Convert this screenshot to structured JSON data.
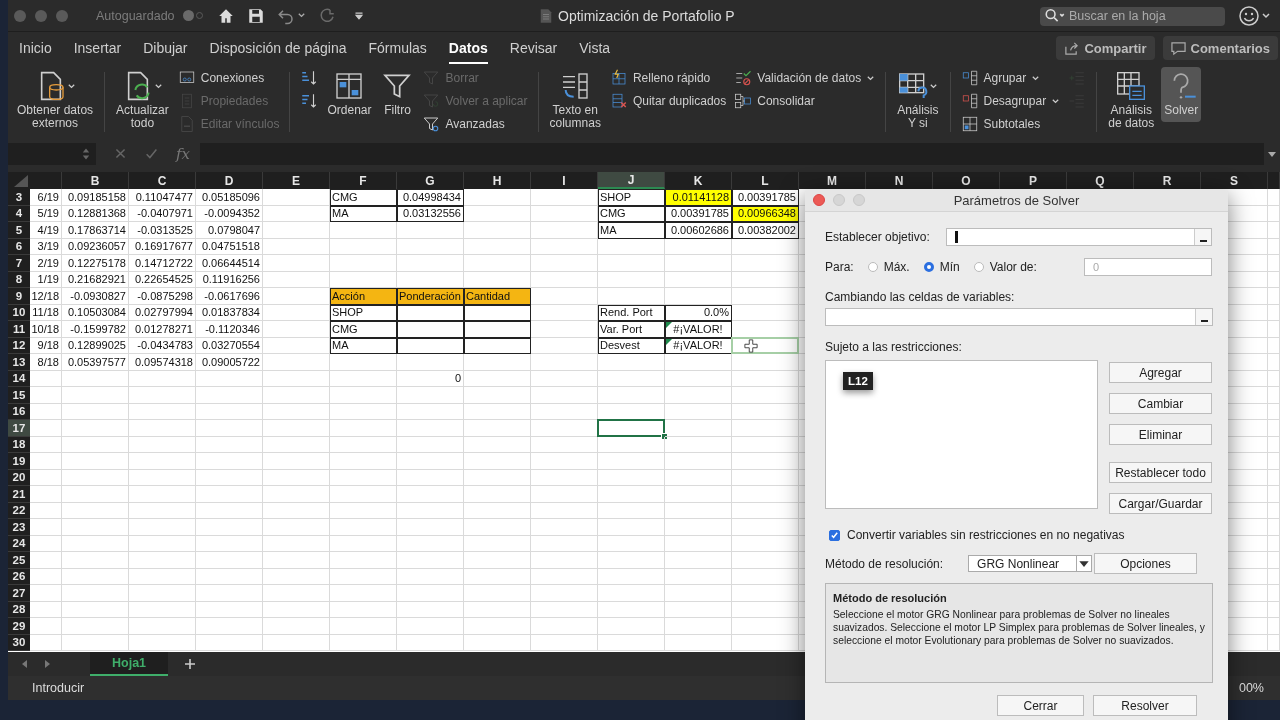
{
  "title_bar": {
    "autosave_label": "Autoguardado",
    "autosave_on": false,
    "title": "Optimización de Portafolio P",
    "search_placeholder": "Buscar en la hoja"
  },
  "tabs": [
    {
      "label": "Inicio",
      "selected": false
    },
    {
      "label": "Insertar",
      "selected": false
    },
    {
      "label": "Dibujar",
      "selected": false
    },
    {
      "label": "Disposición de página",
      "selected": false
    },
    {
      "label": "Fórmulas",
      "selected": false
    },
    {
      "label": "Datos",
      "selected": true
    },
    {
      "label": "Revisar",
      "selected": false
    },
    {
      "label": "Vista",
      "selected": false
    }
  ],
  "actions": [
    "Compartir",
    "Comentarios"
  ],
  "ribbon": [
    {
      "items": [
        {
          "kind": "large",
          "label": "Obtener datos\nexternos",
          "dropdown": true
        }
      ]
    },
    {
      "items": [
        {
          "kind": "large",
          "label": "Actualizar\ntodo",
          "dropdown": true
        },
        {
          "kind": "stack",
          "items": [
            {
              "label": "Conexiones",
              "disabled": false
            },
            {
              "label": "Propiedades",
              "disabled": true
            },
            {
              "label": "Editar vínculos",
              "disabled": true
            }
          ]
        }
      ]
    },
    {
      "items": [
        {
          "kind": "stack",
          "items": [
            {
              "disabled": false
            },
            {
              "disabled": false
            }
          ]
        },
        {
          "kind": "large",
          "label": "Ordenar"
        },
        {
          "kind": "large",
          "label": "Filtro"
        },
        {
          "kind": "stack",
          "items": [
            {
              "label": "Borrar",
              "disabled": true
            },
            {
              "label": "Volver a aplicar",
              "disabled": true
            },
            {
              "label": "Avanzadas",
              "disabled": false
            }
          ]
        }
      ]
    },
    {
      "items": [
        {
          "kind": "large",
          "label": "Texto en\ncolumnas"
        },
        {
          "kind": "stack",
          "items": [
            {
              "label": "Relleno rápido",
              "disabled": false
            },
            {
              "label": "Quitar duplicados",
              "disabled": false
            }
          ]
        },
        {
          "kind": "stack",
          "items": [
            {
              "label": "Validación de datos",
              "disabled": false,
              "dropdown": true
            },
            {
              "label": "Consolidar",
              "disabled": false
            }
          ]
        }
      ]
    },
    {
      "items": [
        {
          "kind": "large",
          "label": "Análisis\nY si",
          "dropdown": true
        }
      ]
    },
    {
      "items": [
        {
          "kind": "stack",
          "items": [
            {
              "label": "Agrupar",
              "disabled": false,
              "dropdown": true
            },
            {
              "label": "Desagrupar",
              "disabled": false,
              "dropdown": true
            },
            {
              "label": "Subtotales",
              "disabled": false
            }
          ]
        },
        {
          "kind": "stack",
          "items": [
            {
              "disabled": true
            },
            {
              "disabled": true
            }
          ]
        }
      ]
    },
    {
      "items": [
        {
          "kind": "large",
          "label": "Análisis\nde datos"
        },
        {
          "kind": "large",
          "label": "Solver",
          "active": true
        }
      ]
    }
  ],
  "formula_bar": {
    "function_label": "fx"
  },
  "sheet": {
    "columns": [
      "B",
      "C",
      "D",
      "E",
      "F",
      "G",
      "H",
      "I",
      "J",
      "K",
      "L",
      "M",
      "N",
      "O",
      "P",
      "Q",
      "R",
      "S"
    ],
    "rows": [
      {
        "num": "3",
        "cells": [
          {
            "text": "6/19",
            "kind": "number"
          },
          {
            "text": "0.09185158",
            "kind": "number"
          },
          {
            "text": "0.11047477",
            "kind": "number"
          },
          {
            "text": "0.05185096",
            "kind": "number"
          },
          null,
          {
            "text": "CMG",
            "kind": "text",
            "boxed": true
          },
          {
            "text": "0.04998434",
            "kind": "number",
            "boxed": true
          },
          null,
          null,
          {
            "text": "SHOP",
            "kind": "text",
            "boxed": true
          },
          {
            "text": "0.01141128",
            "kind": "number",
            "boxed": true,
            "color": "#ffff00"
          },
          {
            "text": "0.00391785",
            "kind": "number",
            "boxed": true
          }
        ]
      },
      {
        "num": "4",
        "cells": [
          {
            "text": "5/19",
            "kind": "number"
          },
          {
            "text": "0.12881368",
            "kind": "number"
          },
          {
            "text": "-0.0407971",
            "kind": "number"
          },
          {
            "text": "-0.0094352",
            "kind": "number"
          },
          null,
          {
            "text": "MA",
            "kind": "text",
            "boxed": true
          },
          {
            "text": "0.03132556",
            "kind": "number",
            "boxed": true
          },
          null,
          null,
          {
            "text": "CMG",
            "kind": "text",
            "boxed": true
          },
          {
            "text": "0.00391785",
            "kind": "number",
            "boxed": true
          },
          {
            "text": "0.00966348",
            "kind": "number",
            "boxed": true,
            "color": "#ffff00"
          }
        ]
      },
      {
        "num": "5",
        "cells": [
          {
            "text": "4/19",
            "kind": "number"
          },
          {
            "text": "0.17863714",
            "kind": "number"
          },
          {
            "text": "-0.0313525",
            "kind": "number"
          },
          {
            "text": "0.0798047",
            "kind": "number"
          },
          null,
          null,
          null,
          null,
          null,
          {
            "text": "MA",
            "kind": "text",
            "boxed": true
          },
          {
            "text": "0.00602686",
            "kind": "number",
            "boxed": true
          },
          {
            "text": "0.00382002",
            "kind": "number",
            "boxed": true
          }
        ]
      },
      {
        "num": "6",
        "cells": [
          {
            "text": "3/19",
            "kind": "number"
          },
          {
            "text": "0.09236057",
            "kind": "number"
          },
          {
            "text": "0.16917677",
            "kind": "number"
          },
          {
            "text": "0.04751518",
            "kind": "number"
          }
        ]
      },
      {
        "num": "7",
        "cells": [
          {
            "text": "2/19",
            "kind": "number"
          },
          {
            "text": "0.12275178",
            "kind": "number"
          },
          {
            "text": "0.14712722",
            "kind": "number"
          },
          {
            "text": "0.06644514",
            "kind": "number"
          }
        ]
      },
      {
        "num": "8",
        "cells": [
          {
            "text": "1/19",
            "kind": "number"
          },
          {
            "text": "0.21682921",
            "kind": "number"
          },
          {
            "text": "0.22654525",
            "kind": "number"
          },
          {
            "text": "0.11916256",
            "kind": "number"
          }
        ]
      },
      {
        "num": "9",
        "cells": [
          {
            "text": "12/18",
            "kind": "number"
          },
          {
            "text": "-0.0930827",
            "kind": "number"
          },
          {
            "text": "-0.0875298",
            "kind": "number"
          },
          {
            "text": "-0.0617696",
            "kind": "number"
          },
          null,
          {
            "text": "Acción",
            "kind": "text",
            "boxed": true,
            "color": "#f4b512"
          },
          {
            "text": "Ponderación",
            "kind": "text",
            "boxed": true,
            "color": "#f4b512"
          },
          {
            "text": "Cantidad",
            "kind": "text",
            "boxed": true,
            "color": "#f4b512"
          }
        ]
      },
      {
        "num": "10",
        "cells": [
          {
            "text": "11/18",
            "kind": "number"
          },
          {
            "text": "0.10503084",
            "kind": "number"
          },
          {
            "text": "0.02797994",
            "kind": "number"
          },
          {
            "text": "0.01837834",
            "kind": "number"
          },
          null,
          {
            "text": "SHOP",
            "kind": "text",
            "boxed": true
          },
          {
            "boxed": true
          },
          {
            "boxed": true
          },
          null,
          {
            "text": "Rend. Port",
            "kind": "text",
            "boxed": true
          },
          {
            "text": "0.0%",
            "kind": "number",
            "boxed": true
          }
        ]
      },
      {
        "num": "11",
        "cells": [
          {
            "text": "10/18",
            "kind": "number"
          },
          {
            "text": "-0.1599782",
            "kind": "number"
          },
          {
            "text": "0.01278271",
            "kind": "number"
          },
          {
            "text": "-0.1120346",
            "kind": "number"
          },
          null,
          {
            "text": "CMG",
            "kind": "text",
            "boxed": true
          },
          {
            "boxed": true
          },
          {
            "boxed": true
          },
          null,
          {
            "text": "Var. Port",
            "kind": "text",
            "boxed": true
          },
          {
            "text": "#¡VALOR!",
            "kind": "error",
            "boxed": true
          }
        ]
      },
      {
        "num": "12",
        "cells": [
          {
            "text": "9/18",
            "kind": "number"
          },
          {
            "text": "0.12899025",
            "kind": "number"
          },
          {
            "text": "-0.0434783",
            "kind": "number"
          },
          {
            "text": "0.03270554",
            "kind": "number"
          },
          null,
          {
            "text": "MA",
            "kind": "text",
            "boxed": true
          },
          {
            "boxed": true
          },
          {
            "boxed": true
          },
          null,
          {
            "text": "Desvest",
            "kind": "text",
            "boxed": true
          },
          {
            "text": "#¡VALOR!",
            "kind": "error",
            "boxed": true
          },
          {
            "referenced": true
          }
        ]
      },
      {
        "num": "13",
        "cells": [
          {
            "text": "8/18",
            "kind": "number"
          },
          {
            "text": "0.05397577",
            "kind": "number"
          },
          {
            "text": "0.09574318",
            "kind": "number"
          },
          {
            "text": "0.09005722",
            "kind": "number"
          }
        ]
      },
      {
        "num": "14",
        "cells": [
          null,
          null,
          null,
          null,
          null,
          null,
          {
            "text": "0",
            "kind": "number"
          }
        ]
      },
      {
        "num": "15"
      },
      {
        "num": "16"
      },
      {
        "num": "17",
        "cells": [
          null,
          null,
          null,
          null,
          null,
          null,
          null,
          null,
          null,
          {
            "selected": true
          }
        ]
      },
      {
        "num": "18"
      },
      {
        "num": "19"
      },
      {
        "num": "20"
      },
      {
        "num": "21"
      },
      {
        "num": "22"
      },
      {
        "num": "23"
      },
      {
        "num": "24"
      },
      {
        "num": "25"
      },
      {
        "num": "26"
      },
      {
        "num": "27"
      },
      {
        "num": "28"
      },
      {
        "num": "29"
      },
      {
        "num": "30"
      }
    ]
  },
  "sheet_tabs": [
    {
      "label": "Hoja1",
      "selected": true
    }
  ],
  "status_bar": {
    "mode": "Introducir",
    "zoom": "00%"
  },
  "dialog": {
    "title": "Parámetros de Solver",
    "objective": {
      "label": "Establecer objetivo:",
      "focused": true
    },
    "to_label": "Para:",
    "options": [
      {
        "label": "Máx.",
        "selected": false
      },
      {
        "label": "Mín",
        "selected": true
      },
      {
        "label": "Valor de:",
        "selected": false
      }
    ],
    "value_field": {
      "value": "0",
      "disabled": true
    },
    "variables": {
      "label": "Cambiando las celdas de variables:"
    },
    "constraints": {
      "label": "Sujeto a las restricciones:",
      "tooltip": "L12"
    },
    "side_buttons": [
      "Agregar",
      "Cambiar",
      "Eliminar",
      "Restablecer todo",
      "Cargar/Guardar"
    ],
    "nonnegative": {
      "label": "Convertir variables sin restricciones en no negativas",
      "checked": true
    },
    "method": {
      "label": "Método de resolución:",
      "value": "GRG Nonlinear"
    },
    "options_button": "Opciones",
    "info": {
      "title": "Método de resolución",
      "text": "Seleccione el motor GRG Nonlinear para problemas de Solver no lineales suavizados. Seleccione el motor LP Simplex para problemas de Solver lineales, y seleccione el motor Evolutionary para problemas de Solver no suavizados."
    },
    "buttons": [
      "Cerrar",
      "Resolver"
    ]
  }
}
